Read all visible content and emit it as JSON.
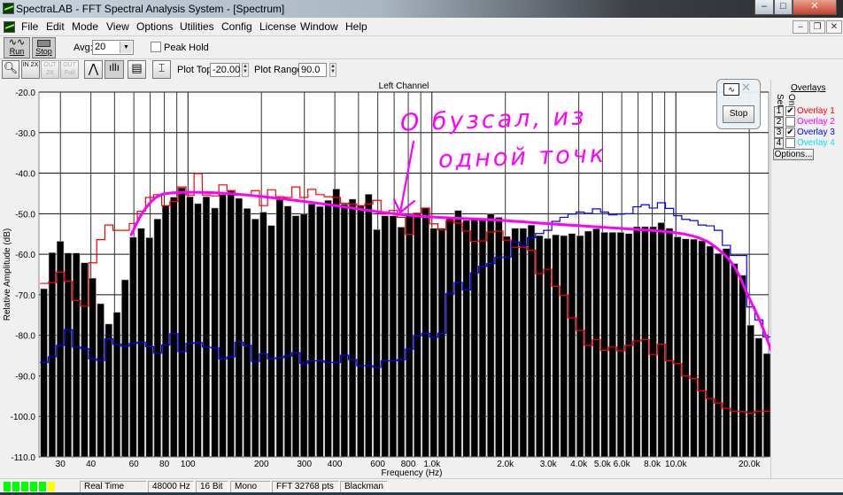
{
  "window": {
    "title": "SpectraLAB - FFT Spectral Analysis System - [Spectrum]",
    "minimize": "–",
    "maximize": "□",
    "close": "✕"
  },
  "menu": [
    "File",
    "Edit",
    "Mode",
    "View",
    "Options",
    "Utilities",
    "Config",
    "License",
    "Window",
    "Help"
  ],
  "mdi": {
    "minimize": "–",
    "restore": "❐",
    "close": "✕"
  },
  "toolbar1": {
    "run_label": "Run",
    "stop_label": "Stop",
    "avg_label": "Avg:",
    "avg_value": "20",
    "peak_hold_label": "Peak Hold",
    "peak_hold_checked": false
  },
  "toolbar2": {
    "zoom_in_2x": "IN 2X",
    "zoom_out_2x": "OUT 2X",
    "zoom_out_full": "OUT Full",
    "plot_top_label": "Plot Top:",
    "plot_top_value": "-20.00",
    "plot_range_label": "Plot Range:",
    "plot_range_value": "90.0"
  },
  "float_window": {
    "stop_label": "Stop"
  },
  "overlays": {
    "title": "Overlays",
    "set_header": "Set",
    "on_header": "On",
    "options_label": "Options...",
    "items": [
      {
        "num": "1",
        "label": "Overlay 1",
        "on": true,
        "color": "#ff0000"
      },
      {
        "num": "2",
        "label": "Overlay 2",
        "on": false,
        "color": "#ff00ff"
      },
      {
        "num": "3",
        "label": "Overlay 3",
        "on": true,
        "color": "#0000ff"
      },
      {
        "num": "4",
        "label": "Overlay 4",
        "on": false,
        "color": "#00ffff"
      }
    ]
  },
  "status": {
    "mode": "Real Time",
    "rate": "48000 Hz",
    "bits": "16 Bit",
    "channels": "Mono",
    "fft": "FFT 32768 pts",
    "window": "Blackman",
    "level_leds": [
      "#00ff00",
      "#00ff00",
      "#00ff00",
      "#00ff00",
      "#00ff00",
      "#ffff00"
    ]
  },
  "annotation": {
    "line1": "О бузсал, из",
    "line2": "одной точк",
    "color": "#ff00ff"
  },
  "chart_data": {
    "type": "bar",
    "title": "Left Channel",
    "xlabel": "Frequency (Hz)",
    "ylabel": "Relative Amplitude (dB)",
    "xscale": "log",
    "xlim": [
      24.5,
      24000
    ],
    "ylim": [
      -110,
      -20
    ],
    "grid": true,
    "yticks": [
      "-20.0",
      "-30.0",
      "-40.0",
      "-50.0",
      "-60.0",
      "-70.0",
      "-80.0",
      "-90.0",
      "-100.0",
      "-110.0"
    ],
    "xticks": [
      {
        "f": 30,
        "label": "30"
      },
      {
        "f": 40,
        "label": "40"
      },
      {
        "f": 60,
        "label": "60"
      },
      {
        "f": 80,
        "label": "80"
      },
      {
        "f": 100,
        "label": "100"
      },
      {
        "f": 200,
        "label": "200"
      },
      {
        "f": 300,
        "label": "300"
      },
      {
        "f": 400,
        "label": "400"
      },
      {
        "f": 600,
        "label": "600"
      },
      {
        "f": 800,
        "label": "800"
      },
      {
        "f": 1000,
        "label": "1.0k"
      },
      {
        "f": 2000,
        "label": "2.0k"
      },
      {
        "f": 3000,
        "label": "3.0k"
      },
      {
        "f": 4000,
        "label": "4.0k"
      },
      {
        "f": 5000,
        "label": "5.0k"
      },
      {
        "f": 6000,
        "label": "6.0k"
      },
      {
        "f": 8000,
        "label": "8.0k"
      },
      {
        "f": 10000,
        "label": "10.0k"
      },
      {
        "f": 20000,
        "label": "20.0k"
      }
    ],
    "frequencies_hz": [
      25.7,
      27.8,
      30.0,
      32.3,
      34.9,
      37.7,
      40.7,
      43.9,
      47.4,
      51.2,
      55.3,
      59.7,
      64.4,
      69.6,
      75.1,
      81.1,
      87.6,
      94.5,
      102,
      110,
      119,
      129,
      139,
      150,
      162,
      175,
      189,
      204,
      220,
      238,
      257,
      277,
      299,
      322,
      348,
      376,
      406,
      438,
      473,
      511,
      551,
      595,
      643,
      694,
      749,
      809,
      873,
      943,
      1018,
      1099,
      1187,
      1283,
      1386,
      1496,
      1615,
      1744,
      1883,
      2033,
      2195,
      2370,
      2559,
      2763,
      2983,
      3221,
      3478,
      3755,
      4054,
      4377,
      4726,
      5103,
      5510,
      5947,
      6421,
      6933,
      7485,
      8082,
      8726,
      9421,
      10172,
      10983,
      11858,
      12803,
      13823,
      14925,
      16115,
      17399,
      18786,
      20283,
      21900,
      23645
    ],
    "series": [
      {
        "kind": "bars",
        "color": "#000000",
        "values": [
          -68.5,
          -59.6,
          -56.8,
          -59.7,
          -59.7,
          -62.1,
          -65.9,
          -72.2,
          -77.2,
          -74.3,
          -66.3,
          -55.8,
          -53.6,
          -55.9,
          -51.3,
          -48.0,
          -45.9,
          -43.6,
          -45.8,
          -47.5,
          -45.8,
          -48.6,
          -45.3,
          -44.3,
          -46.2,
          -48.7,
          -51.3,
          -49.6,
          -52.9,
          -46.5,
          -48.1,
          -50.5,
          -50.1,
          -47.6,
          -48.2,
          -46.7,
          -43.9,
          -47.6,
          -46.4,
          -48.0,
          -45.2,
          -53.9,
          -50.5,
          -50.5,
          -53.3,
          -50.1,
          -49.8,
          -48.6,
          -53.6,
          -53.6,
          -50.9,
          -49.2,
          -51.6,
          -51.0,
          -51.6,
          -50.1,
          -50.9,
          -55.6,
          -53.6,
          -53.6,
          -52.8,
          -55.4,
          -56.1,
          -55.2,
          -55.4,
          -54.9,
          -55.4,
          -54.3,
          -53.7,
          -54.6,
          -54.6,
          -54.6,
          -54.9,
          -53.2,
          -53.2,
          -53.2,
          -52.2,
          -53.6,
          -55.7,
          -56.2,
          -56.3,
          -56.7,
          -58.0,
          -59.8,
          -58.6,
          -62.3,
          -65.2,
          -77.5,
          -80.7,
          -84.5
        ]
      },
      {
        "name": "Overlay 1",
        "kind": "step",
        "color": "#ff0000",
        "values": [
          -67.2,
          -67.0,
          -64.4,
          -66.7,
          -71.4,
          -72.8,
          -62.1,
          -56.4,
          -52.8,
          -54.1,
          -54.1,
          -52.4,
          -49.4,
          -46.0,
          -45.3,
          -48.0,
          -47.0,
          -43.4,
          -45.4,
          -40.1,
          -45.4,
          -45.6,
          -42.9,
          -44.3,
          -45.4,
          -45.4,
          -44.3,
          -48.0,
          -44.1,
          -45.8,
          -46.0,
          -43.4,
          -46.0,
          -44.0,
          -45.3,
          -45.8,
          -46.0,
          -47.4,
          -47.6,
          -48.0,
          -47.6,
          -46.7,
          -50.1,
          -49.2,
          -50.9,
          -55.1,
          -49.9,
          -48.6,
          -52.5,
          -54.0,
          -51.7,
          -52.3,
          -54.3,
          -56.8,
          -56.7,
          -54.5,
          -54.3,
          -56.5,
          -58.3,
          -58.3,
          -59.0,
          -64.8,
          -63.7,
          -67.9,
          -70.2,
          -75.7,
          -78.8,
          -82.5,
          -81.1,
          -83.7,
          -82.9,
          -83.8,
          -82.5,
          -81.4,
          -81.1,
          -84.7,
          -82.2,
          -86.3,
          -87.0,
          -90.0,
          -90.7,
          -93.7,
          -95.6,
          -96.7,
          -98.0,
          -98.7,
          -98.8,
          -99.2,
          -98.7,
          -98.7
        ]
      },
      {
        "name": "Overlay 3",
        "kind": "step",
        "color": "#0000ff",
        "values": [
          -86.7,
          -85.3,
          -82.5,
          -78.6,
          -82.9,
          -83.3,
          -85.8,
          -86.2,
          -80.9,
          -82.2,
          -82.7,
          -82.0,
          -81.7,
          -82.8,
          -84.4,
          -82.4,
          -79.6,
          -84.0,
          -82.0,
          -81.8,
          -82.9,
          -83.1,
          -85.8,
          -85.3,
          -81.7,
          -82.5,
          -86.4,
          -84.6,
          -85.8,
          -85.5,
          -85.1,
          -84.3,
          -86.9,
          -86.3,
          -86.3,
          -86.7,
          -86.7,
          -84.9,
          -86.0,
          -87.5,
          -87.5,
          -87.9,
          -86.3,
          -86.3,
          -86.0,
          -83.4,
          -80.1,
          -79.5,
          -80.5,
          -79.5,
          -69.7,
          -67.0,
          -68.8,
          -64.6,
          -63.0,
          -62.3,
          -60.8,
          -60.7,
          -57.0,
          -57.9,
          -55.9,
          -54.9,
          -54.1,
          -51.9,
          -50.9,
          -50.1,
          -49.6,
          -49.9,
          -48.8,
          -49.6,
          -50.3,
          -50.1,
          -50.0,
          -48.3,
          -47.8,
          -48.6,
          -47.3,
          -48.7,
          -50.5,
          -51.4,
          -51.7,
          -52.8,
          -53.0,
          -54.1,
          -57.8,
          -60.3,
          -60.3,
          -73.0,
          -76.2,
          -80.4
        ]
      }
    ],
    "annotation_curve": {
      "color": "#ff00ff",
      "points": [
        [
          58.5,
          -55.2
        ],
        [
          64.7,
          -49.7
        ],
        [
          73.4,
          -45.8
        ],
        [
          83.2,
          -44.7
        ],
        [
          137,
          -44.7
        ],
        [
          268,
          -46.6
        ],
        [
          407,
          -48.0
        ],
        [
          617,
          -49.7
        ],
        [
          937,
          -50.8
        ],
        [
          1832,
          -51.5
        ],
        [
          3015,
          -52.5
        ],
        [
          5893,
          -53.6
        ],
        [
          9800,
          -54.5
        ],
        [
          12560,
          -55.8
        ],
        [
          14840,
          -58.4
        ],
        [
          17500,
          -62.8
        ],
        [
          19830,
          -70.5
        ],
        [
          22440,
          -77.0
        ],
        [
          25850,
          -87.5
        ]
      ]
    }
  }
}
